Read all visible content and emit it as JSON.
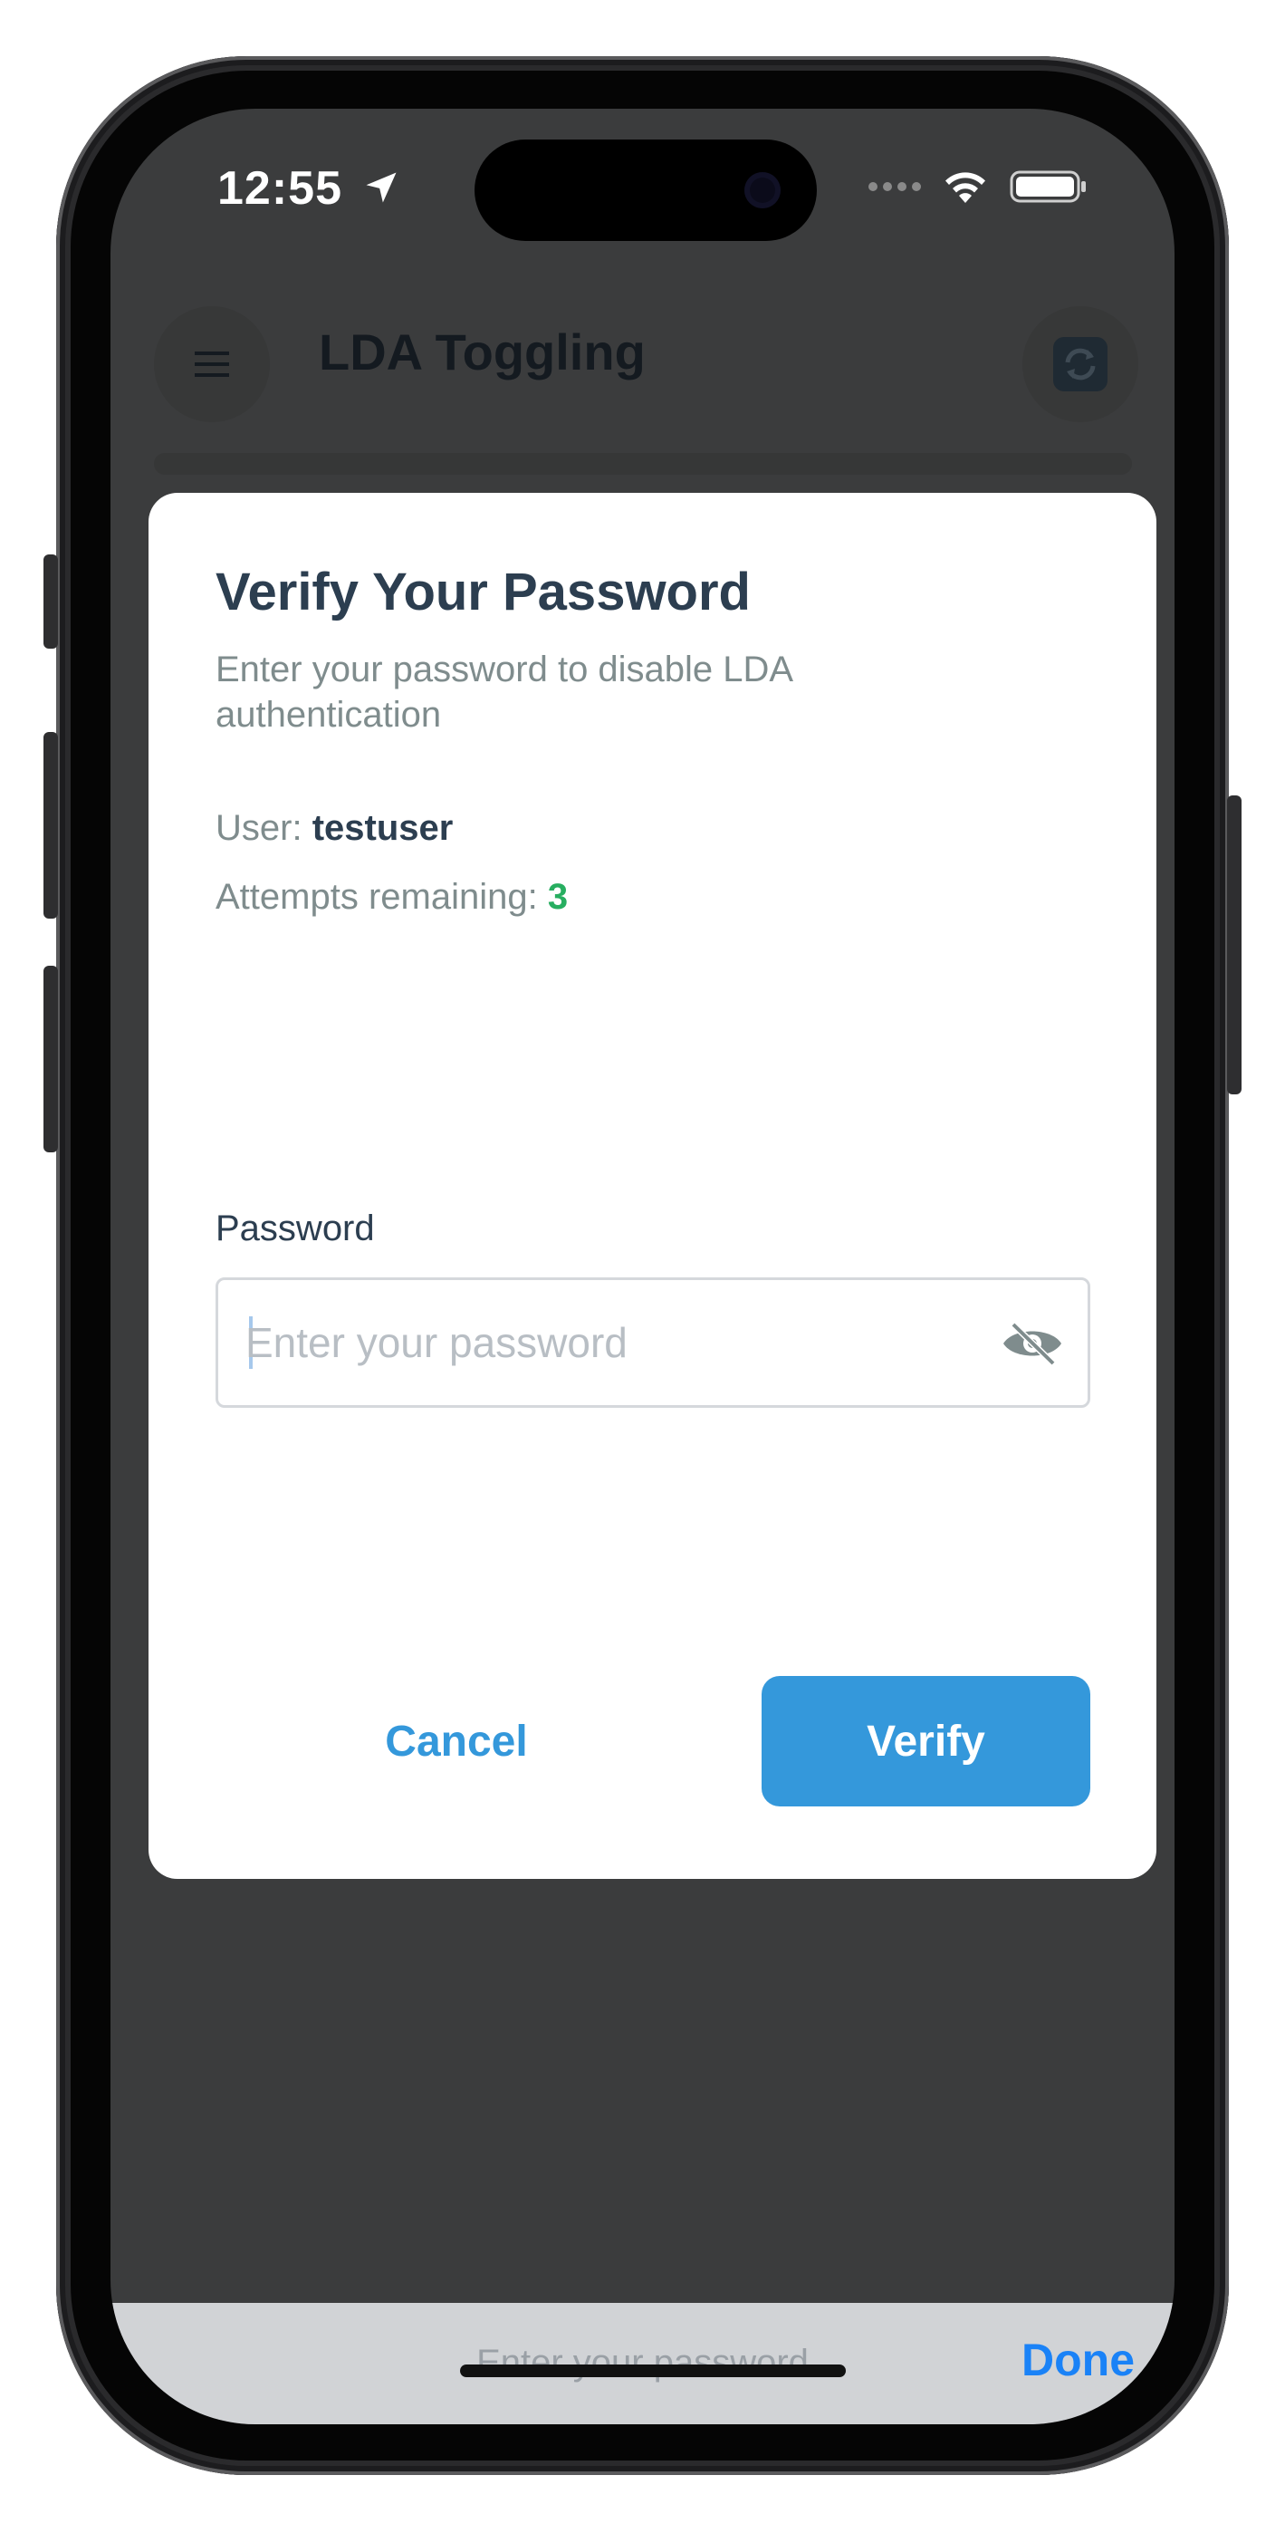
{
  "status_bar": {
    "time": "12:55",
    "icons": [
      "location-arrow-icon",
      "cellular-dots-icon",
      "wifi-icon",
      "battery-icon"
    ]
  },
  "app_header": {
    "title": "LDA Toggling",
    "icons": [
      "hamburger-menu-icon",
      "refresh-icon"
    ]
  },
  "modal": {
    "title": "Verify Your Password",
    "subtitle": "Enter your password to disable LDA authentication",
    "user_label": "User:",
    "user_value": "testuser",
    "attempts_label": "Attempts remaining:",
    "attempts_value": "3",
    "password_label": "Password",
    "password_value": "",
    "password_placeholder": "Enter your password",
    "visibility_icon": "eye-slash-icon",
    "cancel_label": "Cancel",
    "verify_label": "Verify"
  },
  "keyboard_accessory": {
    "placeholder": "Enter your password",
    "done_label": "Done"
  },
  "colors": {
    "primary": "#3498db",
    "title_text": "#2c3e50",
    "muted_text": "#7f8c8d",
    "success": "#27ae60",
    "done_blue": "#1a82f7",
    "backdrop": "#3b3c3d"
  }
}
